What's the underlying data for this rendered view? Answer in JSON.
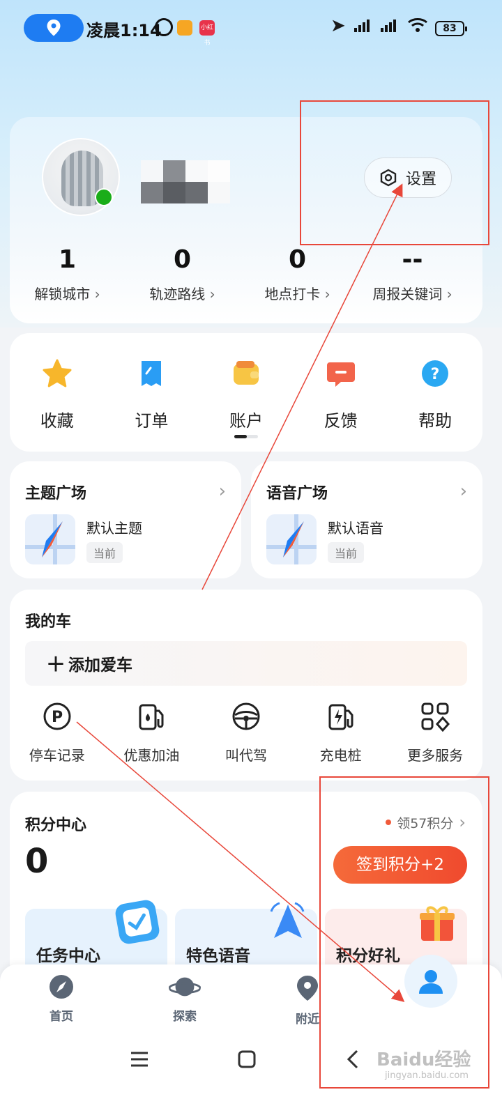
{
  "status_bar": {
    "time": "凌晨1:14",
    "app2_label": "小红书",
    "battery": "83"
  },
  "profile": {
    "settings_label": "设置",
    "stats": [
      {
        "value": "1",
        "label": "解锁城市"
      },
      {
        "value": "0",
        "label": "轨迹路线"
      },
      {
        "value": "0",
        "label": "地点打卡"
      },
      {
        "value": "--",
        "label": "周报关键词"
      }
    ]
  },
  "shortcuts": [
    {
      "label": "收藏",
      "icon": "star-icon",
      "color": "#f7b62b"
    },
    {
      "label": "订单",
      "icon": "order-icon",
      "color": "#2a9df4"
    },
    {
      "label": "账户",
      "icon": "wallet-icon",
      "color": "#f7c544"
    },
    {
      "label": "反馈",
      "icon": "feedback-icon",
      "color": "#f2644b"
    },
    {
      "label": "帮助",
      "icon": "help-icon",
      "color": "#2aa8f2"
    }
  ],
  "theme_plaza": {
    "title": "主题广场",
    "item": "默认主题",
    "tag": "当前"
  },
  "voice_plaza": {
    "title": "语音广场",
    "item": "默认语音",
    "tag": "当前"
  },
  "my_car": {
    "title": "我的车",
    "add_label": "添加爱车",
    "services": [
      {
        "label": "停车记录",
        "icon": "parking-icon"
      },
      {
        "label": "优惠加油",
        "icon": "fuel-icon"
      },
      {
        "label": "叫代驾",
        "icon": "steering-wheel-icon"
      },
      {
        "label": "充电桩",
        "icon": "charger-icon"
      },
      {
        "label": "更多服务",
        "icon": "grid-icon"
      }
    ]
  },
  "points": {
    "title": "积分中心",
    "claim_label": "领57积分",
    "value": "0",
    "checkin_label": "签到积分+2",
    "promos": [
      {
        "label": "任务中心",
        "bg": "#e6f2fd"
      },
      {
        "label": "特色语音",
        "bg": "#eaf3fd"
      },
      {
        "label": "积分好礼",
        "bg": "#fdeceb"
      }
    ]
  },
  "tab_bar": {
    "tabs": [
      {
        "label": "首页",
        "icon": "compass-icon"
      },
      {
        "label": "探索",
        "icon": "planet-icon"
      },
      {
        "label": "附近",
        "icon": "location-pin-icon"
      }
    ]
  },
  "watermark": {
    "brand": "Baidu经验",
    "url": "jingyan.baidu.com"
  },
  "colors": {
    "accent": "#1e7cf2",
    "annotation": "#e8473a",
    "checkin": "#f25a34"
  }
}
